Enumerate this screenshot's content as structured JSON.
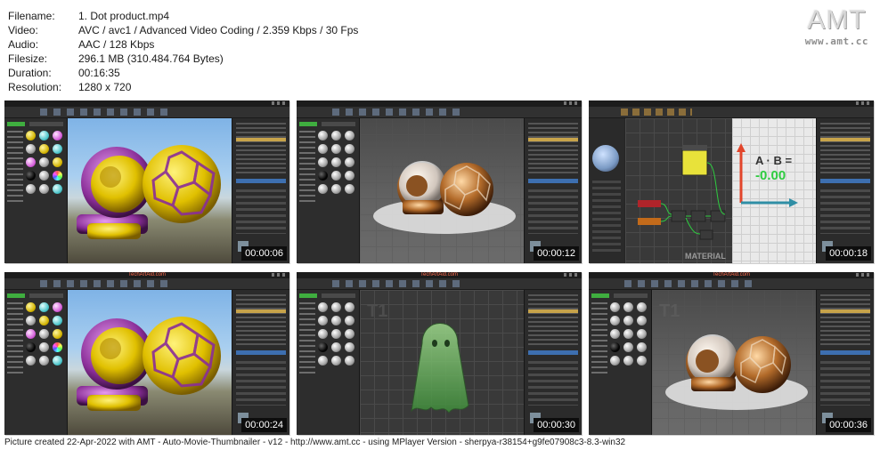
{
  "info": {
    "rows": [
      {
        "key": "Filename:",
        "value": "1. Dot product.mp4"
      },
      {
        "key": "Video:",
        "value": "AVC / avc1 / Advanced Video Coding / 2.359 Kbps / 30 Fps"
      },
      {
        "key": "Audio:",
        "value": "AAC / 128 Kbps"
      },
      {
        "key": "Filesize:",
        "value": "296.1 MB (310.484.764 Bytes)"
      },
      {
        "key": "Duration:",
        "value": "00:16:35"
      },
      {
        "key": "Resolution:",
        "value": "1280 x 720"
      }
    ]
  },
  "logo": {
    "mark": "AMT",
    "site": "www.amt.cc"
  },
  "thumbnails": [
    {
      "timestamp": "00:00:06",
      "scene": "sky-yellow-spheres",
      "watermark": ""
    },
    {
      "timestamp": "00:00:12",
      "scene": "copper-spheres",
      "watermark": ""
    },
    {
      "timestamp": "00:00:18",
      "scene": "material-graph",
      "watermark": "",
      "overlay_text": "A · B =",
      "overlay_value": "-0.00",
      "corner_label": "MATERIAL"
    },
    {
      "timestamp": "00:00:24",
      "scene": "sky-yellow-spheres",
      "watermark": "TechArtAid.com"
    },
    {
      "timestamp": "00:00:30",
      "scene": "green-ghost",
      "watermark": "TechArtAid.com"
    },
    {
      "timestamp": "00:00:36",
      "scene": "copper-spheres",
      "watermark": "TechArtAid.com"
    }
  ],
  "footer": "Picture created 22-Apr-2022 with AMT - Auto-Movie-Thumbnailer - v12 - http://www.amt.cc - using MPlayer Version - sherpya-r38154+g9fe07908c3-8.3-win32",
  "colors": {
    "timestamp_bg": "#0d0d0d",
    "ue_dark": "#262626",
    "accent_orange": "#c7a34a",
    "material_yellow": "#e8e23a",
    "material_green": "#2ecc40",
    "vector_red": "#e2452b",
    "vector_teal": "#2f8ea5"
  }
}
